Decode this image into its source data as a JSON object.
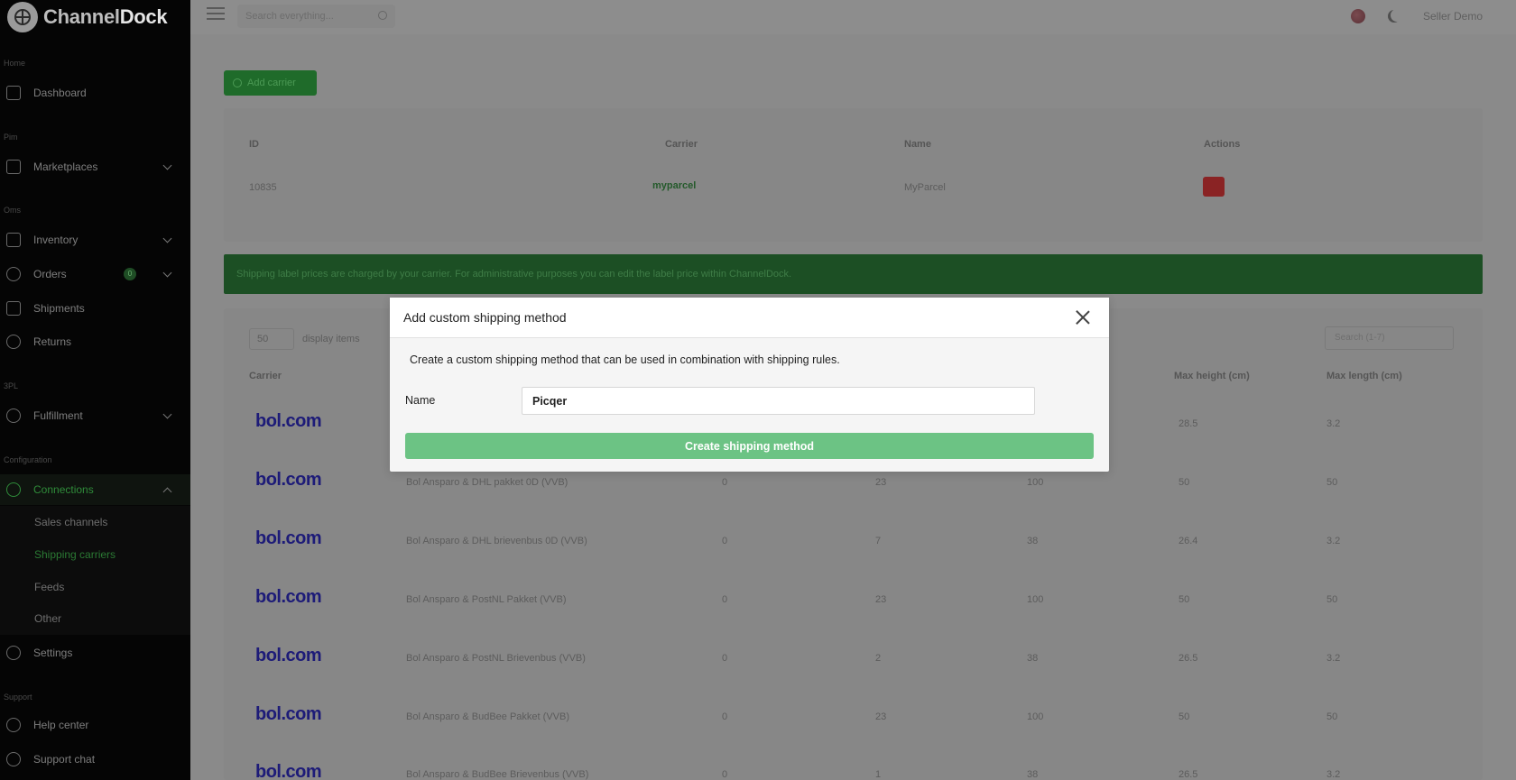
{
  "app": {
    "logo_prefix": "Channel",
    "logo_suffix": "Dock"
  },
  "sidebar": {
    "sections": [
      "Home",
      "Pim",
      "Oms",
      "3PL",
      "Configuration",
      "Support"
    ],
    "items": [
      {
        "label": "Dashboard",
        "icon": "calendar-icon"
      },
      {
        "label": "Marketplaces",
        "icon": "cart-icon"
      },
      {
        "label": "Inventory",
        "icon": "box-icon"
      },
      {
        "label": "Orders",
        "icon": "orders-icon",
        "badge": "0"
      },
      {
        "label": "Shipments",
        "icon": "truck-icon"
      },
      {
        "label": "Returns",
        "icon": "return-icon"
      },
      {
        "label": "Fulfillment",
        "icon": "warehouse-icon"
      },
      {
        "label": "Connections",
        "icon": "share-icon"
      },
      {
        "label": "Settings",
        "icon": "gear-icon"
      },
      {
        "label": "Help center",
        "icon": "help-icon"
      },
      {
        "label": "Support chat",
        "icon": "chat-icon"
      }
    ],
    "sub_items": [
      "Sales channels",
      "Shipping carriers",
      "Feeds",
      "Other"
    ]
  },
  "topbar": {
    "search_placeholder": "Search everything...",
    "user_name": "Seller Demo"
  },
  "main": {
    "add_carrier_label": "Add carrier",
    "carriers_table": {
      "headers": [
        "ID",
        "Carrier",
        "Name",
        "Actions"
      ],
      "rows": [
        {
          "id": "10835",
          "carrier": "myparcel",
          "name": "MyParcel"
        }
      ]
    },
    "alert_text": "Shipping label prices are charged by your carrier. For administrative purposes you can edit the label price within ChannelDock.",
    "methods_table": {
      "per_page": "50",
      "per_page_label": "display items",
      "search_placeholder": "Search (1-7)",
      "headers": [
        "Carrier",
        "Max height (cm)",
        "Max length (cm)"
      ],
      "rows": [
        {
          "logo": "bol.com",
          "name": "",
          "c1": "",
          "c2": "",
          "c3": "",
          "c4": "28.5",
          "c5": "3.2"
        },
        {
          "logo": "bol.com",
          "name": "Bol Ansparo & DHL pakket 0D (VVB)",
          "c1": "0",
          "c2": "23",
          "c3": "100",
          "c4": "50",
          "c5": "50"
        },
        {
          "logo": "bol.com",
          "name": "Bol Ansparo & DHL brievenbus 0D (VVB)",
          "c1": "0",
          "c2": "7",
          "c3": "38",
          "c4": "26.4",
          "c5": "3.2"
        },
        {
          "logo": "bol.com",
          "name": "Bol Ansparo & PostNL Pakket (VVB)",
          "c1": "0",
          "c2": "23",
          "c3": "100",
          "c4": "50",
          "c5": "50"
        },
        {
          "logo": "bol.com",
          "name": "Bol Ansparo & PostNL Brievenbus (VVB)",
          "c1": "0",
          "c2": "2",
          "c3": "38",
          "c4": "26.5",
          "c5": "3.2"
        },
        {
          "logo": "bol.com",
          "name": "Bol Ansparo & BudBee Pakket (VVB)",
          "c1": "0",
          "c2": "23",
          "c3": "100",
          "c4": "50",
          "c5": "50"
        },
        {
          "logo": "bol.com",
          "name": "Bol Ansparo & BudBee Brievenbus (VVB)",
          "c1": "0",
          "c2": "1",
          "c3": "38",
          "c4": "26.5",
          "c5": "3.2"
        }
      ]
    }
  },
  "modal": {
    "title": "Add custom shipping method",
    "description": "Create a custom shipping method that can be used in combination with shipping rules.",
    "name_label": "Name",
    "name_value": "Picqer",
    "submit_label": "Create shipping method"
  },
  "colors": {
    "accent_green": "#6cc384",
    "brand_bol": "#1d1b78",
    "danger": "#8a2324"
  }
}
